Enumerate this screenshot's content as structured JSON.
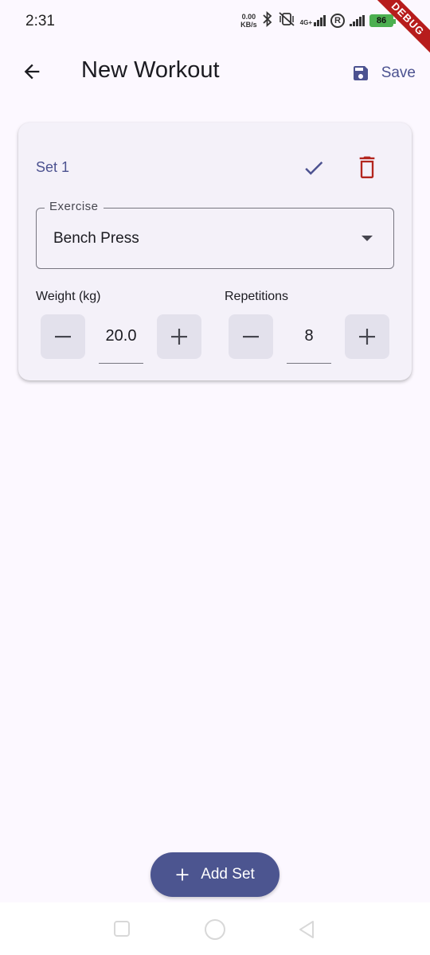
{
  "status_bar": {
    "time": "2:31",
    "net_speed_value": "0.00",
    "net_speed_unit": "KB/s",
    "network_type": "4G+",
    "roaming_indicator": "R",
    "battery_level": "86",
    "debug_banner": "DEBUG"
  },
  "app_bar": {
    "title": "New Workout",
    "save_label": "Save"
  },
  "set_card": {
    "title": "Set 1",
    "exercise": {
      "label": "Exercise",
      "value": "Bench Press"
    },
    "weight": {
      "label": "Weight (kg)",
      "value": "20.0"
    },
    "repetitions": {
      "label": "Repetitions",
      "value": "8"
    }
  },
  "fab": {
    "label": "Add Set"
  },
  "colors": {
    "primary": "#4c5290",
    "fab_background": "#4c5590",
    "delete": "#b3261e",
    "background": "#fcf8ff",
    "card": "#f4f1f9"
  }
}
